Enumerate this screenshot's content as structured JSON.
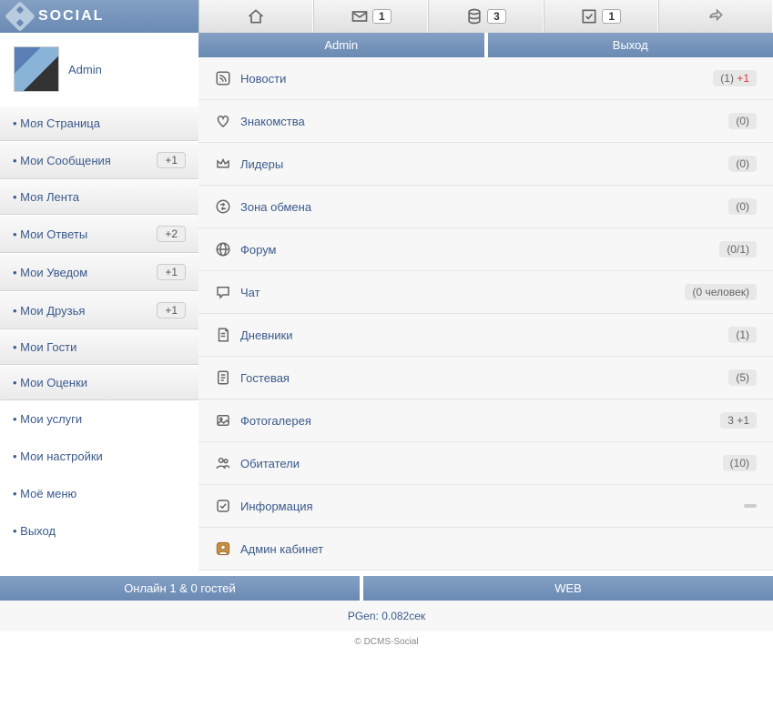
{
  "logo": "SOCIAL",
  "topbar_badges": {
    "mail": "1",
    "stack": "3",
    "check": "1"
  },
  "tabs": {
    "admin": "Admin",
    "exit": "Выход"
  },
  "user": {
    "name": "Admin"
  },
  "sidebar": [
    {
      "label": "• Моя Страница",
      "badge": null,
      "plain": false
    },
    {
      "label": "• Мои Сообщения",
      "badge": "+1",
      "plain": false
    },
    {
      "label": "• Моя Лента",
      "badge": null,
      "plain": false
    },
    {
      "label": "• Мои Ответы",
      "badge": "+2",
      "plain": false
    },
    {
      "label": "• Мои Уведом",
      "badge": "+1",
      "plain": false
    },
    {
      "label": "• Мои Друзья",
      "badge": "+1",
      "plain": false
    },
    {
      "label": "• Мои Гости",
      "badge": null,
      "plain": false
    },
    {
      "label": "• Мои Оценки",
      "badge": null,
      "plain": false
    },
    {
      "label": "• Мои услуги",
      "badge": null,
      "plain": true
    },
    {
      "label": "• Мои настройки",
      "badge": null,
      "plain": true
    },
    {
      "label": "• Моё меню",
      "badge": null,
      "plain": true
    },
    {
      "label": "• Выход",
      "badge": null,
      "plain": true
    }
  ],
  "feed": [
    {
      "icon": "rss",
      "label": "Новости",
      "count": "(1)",
      "new": "+1"
    },
    {
      "icon": "heart",
      "label": "Знакомства",
      "count": "(0)",
      "new": null
    },
    {
      "icon": "crown",
      "label": "Лидеры",
      "count": "(0)",
      "new": null
    },
    {
      "icon": "exchange",
      "label": "Зона обмена",
      "count": "(0)",
      "new": null
    },
    {
      "icon": "globe",
      "label": "Форум",
      "count": "(0/1)",
      "new": null
    },
    {
      "icon": "chat",
      "label": "Чат",
      "count": "(0 человек)",
      "new": null
    },
    {
      "icon": "book",
      "label": "Дневники",
      "count": "(1)",
      "new": null
    },
    {
      "icon": "guest",
      "label": "Гостевая",
      "count": "(5)",
      "new": null
    },
    {
      "icon": "photo",
      "label": "Фотогалерея",
      "count": "3 +1",
      "new": null
    },
    {
      "icon": "users",
      "label": "Обитатели",
      "count": "(10)",
      "new": null
    },
    {
      "icon": "info",
      "label": "Информация",
      "count": null,
      "new": null,
      "dash": true
    },
    {
      "icon": "admin",
      "label": "Админ кабинет",
      "count": null,
      "new": null
    }
  ],
  "footer": {
    "online": "Онлайн 1 & 0 гостей",
    "web": "WEB",
    "pgen": "PGen: 0.082сек",
    "copyright": "© DCMS-Social"
  }
}
